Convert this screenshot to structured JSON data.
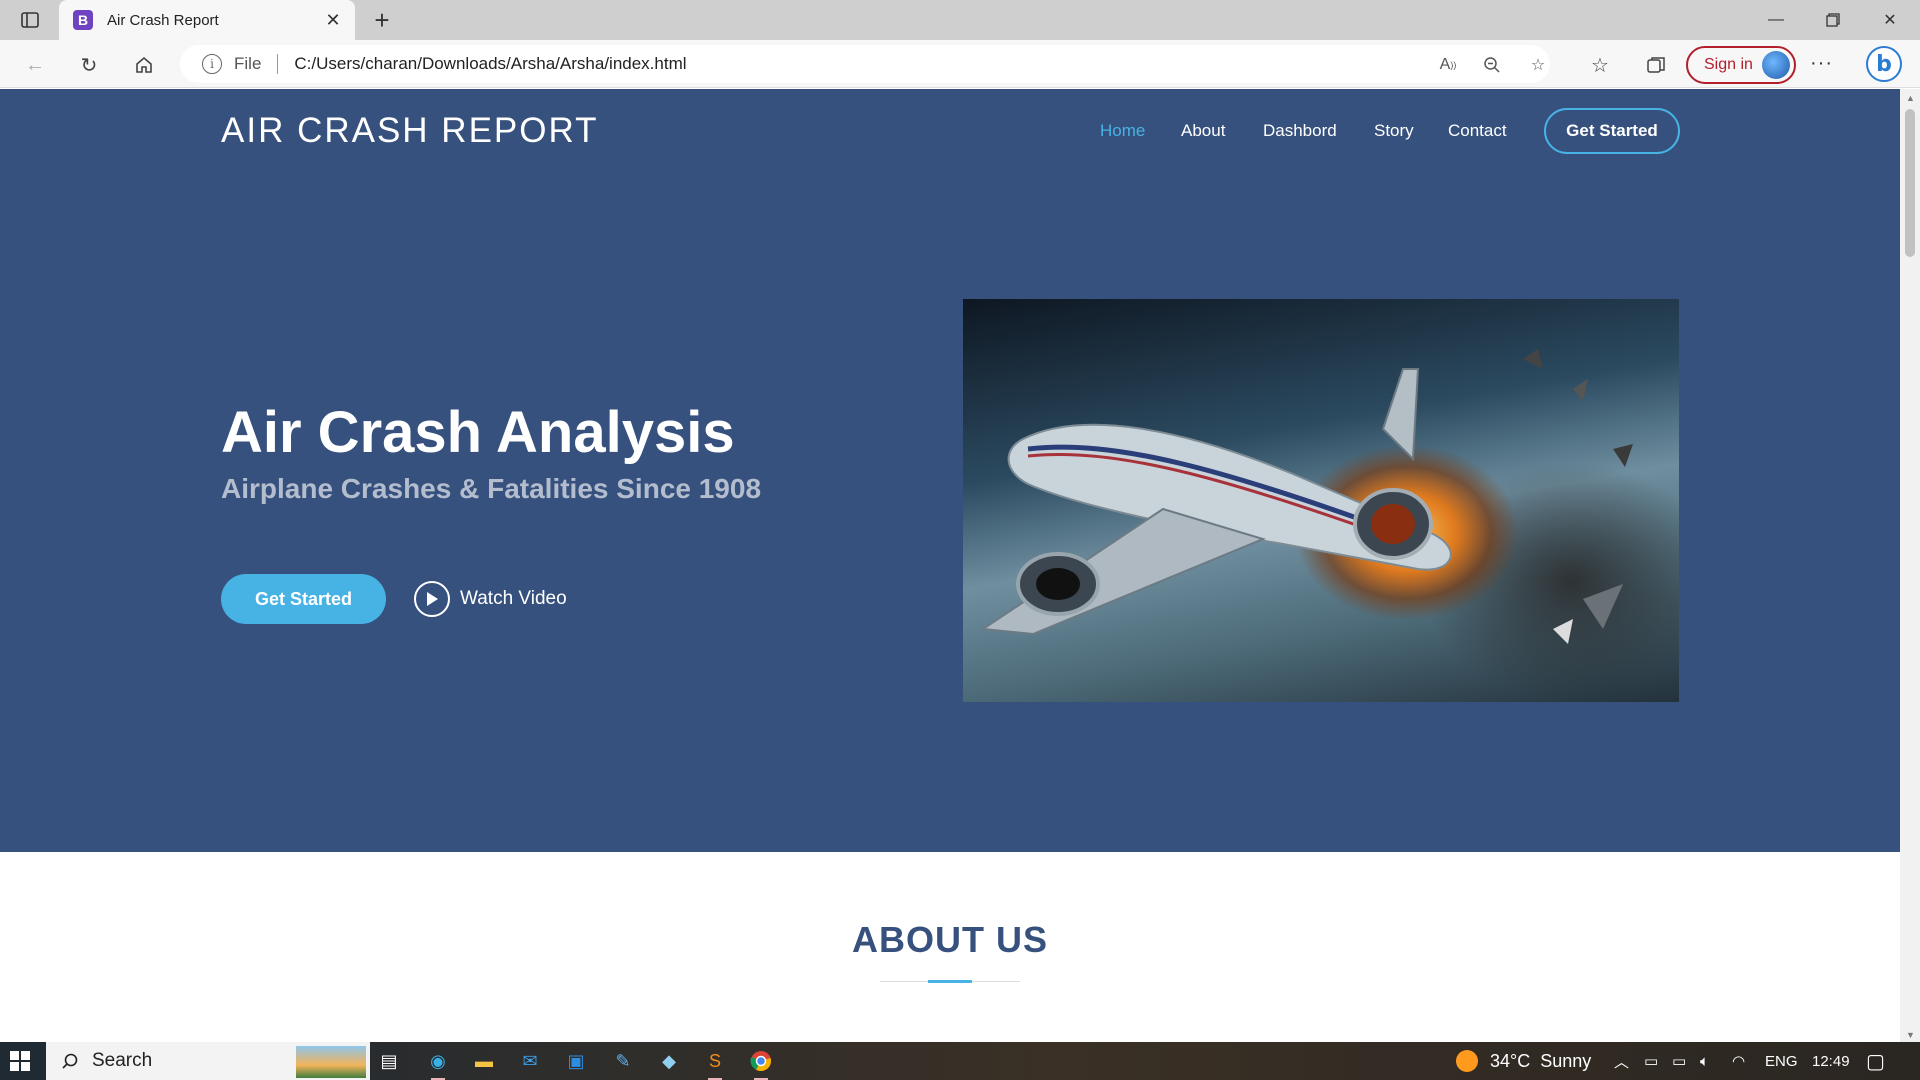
{
  "browser": {
    "tab_title": "Air Crash Report",
    "tab_favicon_letter": "B",
    "url_scheme_label": "File",
    "url": "C:/Users/charan/Downloads/Arsha/Arsha/index.html",
    "signin_label": "Sign in"
  },
  "site": {
    "logo": "AIR CRASH REPORT",
    "nav": [
      {
        "label": "Home",
        "active": true
      },
      {
        "label": "About",
        "active": false
      },
      {
        "label": "Dashbord",
        "active": false
      },
      {
        "label": "Story",
        "active": false
      },
      {
        "label": "Contact",
        "active": false
      }
    ],
    "nav_cta": "Get Started",
    "hero": {
      "title": "Air Crash Analysis",
      "subtitle": "Airplane Crashes & Fatalities Since 1908",
      "cta": "Get Started",
      "watch_video": "Watch Video"
    },
    "about_title": "ABOUT US"
  },
  "taskbar": {
    "search_label": "Search",
    "weather": "34°C  Sunny",
    "language": "ENG",
    "time": "12:49"
  },
  "colors": {
    "hero_bg": "#37517e",
    "accent": "#47b2e4"
  }
}
